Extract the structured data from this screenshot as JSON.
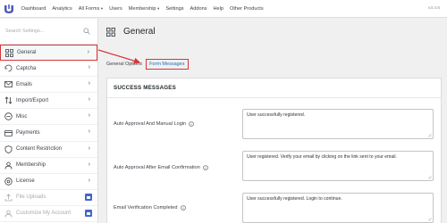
{
  "topbar": {
    "nav": [
      {
        "label": "Dashboard",
        "caret": false
      },
      {
        "label": "Analytics",
        "caret": false
      },
      {
        "label": "All Forms",
        "caret": true
      },
      {
        "label": "Users",
        "caret": false
      },
      {
        "label": "Membership",
        "caret": true
      },
      {
        "label": "Settings",
        "caret": false
      },
      {
        "label": "Addons",
        "caret": false
      },
      {
        "label": "Help",
        "caret": false
      },
      {
        "label": "Other Products",
        "caret": false
      }
    ],
    "version": "v3.4.6"
  },
  "sidebar": {
    "search_placeholder": "Search Settings...",
    "items": [
      {
        "label": "General",
        "icon": "grid-icon"
      },
      {
        "label": "Captcha",
        "icon": "captcha-icon"
      },
      {
        "label": "Emails",
        "icon": "email-icon"
      },
      {
        "label": "Import/Export",
        "icon": "import-export-icon"
      },
      {
        "label": "Misc",
        "icon": "misc-icon"
      },
      {
        "label": "Payments",
        "icon": "payment-icon"
      },
      {
        "label": "Content Restriction",
        "icon": "shield-icon"
      },
      {
        "label": "Membership",
        "icon": "membership-icon"
      },
      {
        "label": "License",
        "icon": "license-icon"
      },
      {
        "label": "File Uploads",
        "icon": "file-upload-icon"
      },
      {
        "label": "Customize My Account",
        "icon": "customize-icon"
      }
    ]
  },
  "main": {
    "title": "General",
    "tabs": [
      "General Options",
      "Form Messages"
    ],
    "section_title": "SUCCESS MESSAGES",
    "rows": [
      {
        "label": "Auto Approval And Manual Login",
        "value": "User successfully registered."
      },
      {
        "label": "Auto Approval After Email Confirmation",
        "value": "User registered. Verify your email by clicking on the link sent to your email."
      },
      {
        "label": "Email Verification Completed",
        "value": "User successfully registered. Login to continue."
      }
    ]
  },
  "colors": {
    "accent": "#2271b1",
    "highlight": "#d63638",
    "lock": "#4466c7"
  }
}
